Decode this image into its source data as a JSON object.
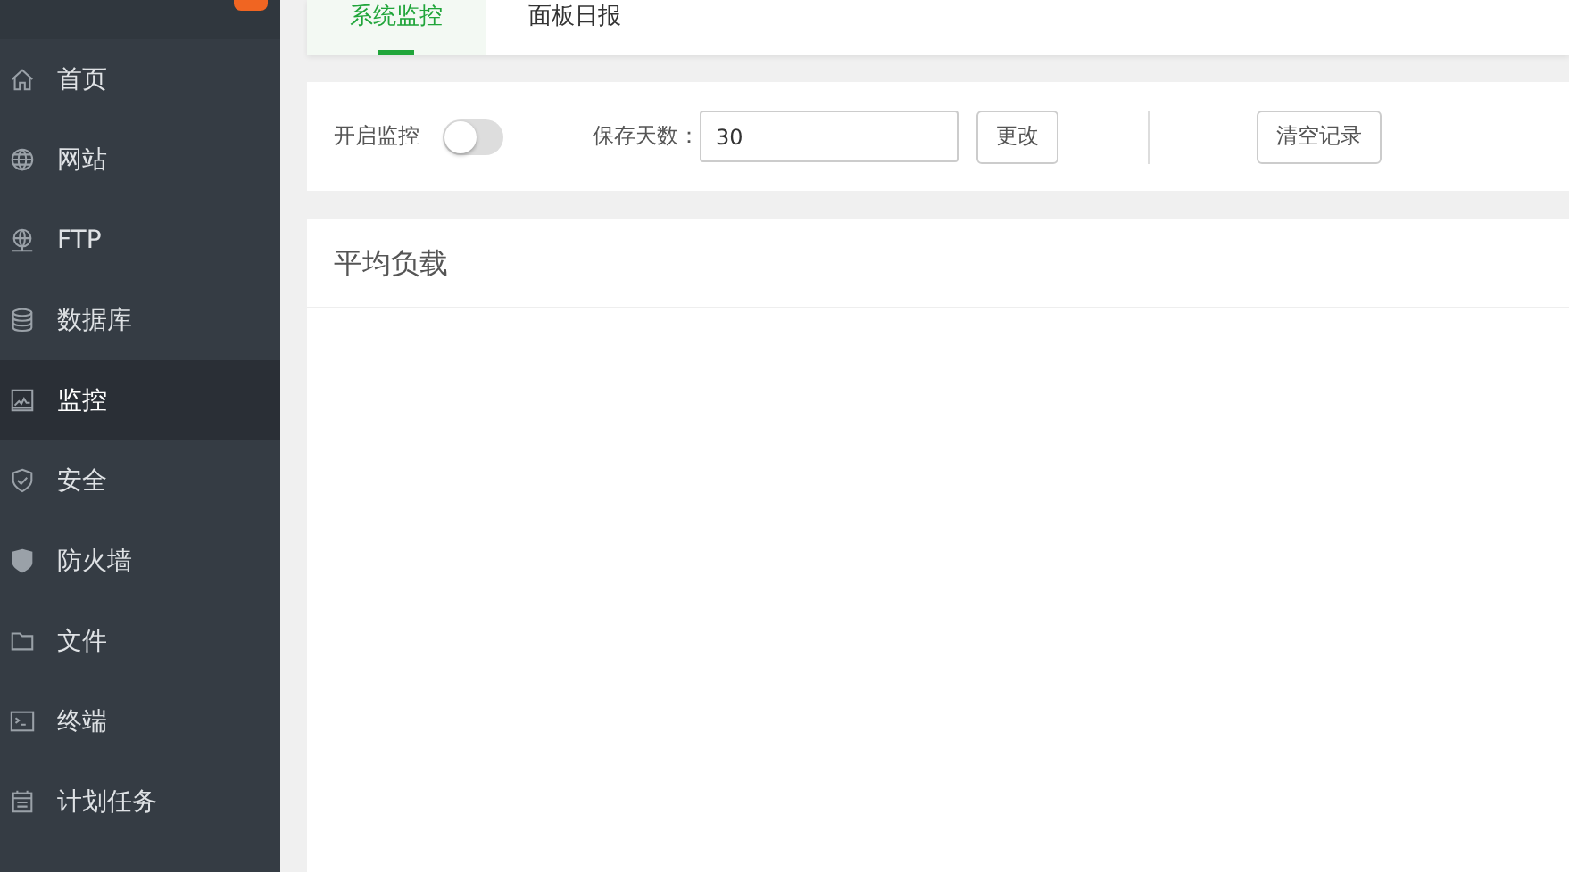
{
  "sidebar": {
    "items": [
      {
        "label": "首页",
        "kind": "home",
        "selected": false
      },
      {
        "label": "网站",
        "kind": "globe",
        "selected": false
      },
      {
        "label": "FTP",
        "kind": "ftp",
        "selected": false
      },
      {
        "label": "数据库",
        "kind": "database",
        "selected": false
      },
      {
        "label": "监控",
        "kind": "monitor",
        "selected": true
      },
      {
        "label": "安全",
        "kind": "shield",
        "selected": false
      },
      {
        "label": "防火墙",
        "kind": "firewall",
        "selected": false
      },
      {
        "label": "文件",
        "kind": "folder",
        "selected": false
      },
      {
        "label": "终端",
        "kind": "terminal",
        "selected": false
      },
      {
        "label": "计划任务",
        "kind": "calendar",
        "selected": false
      }
    ]
  },
  "tabs": [
    {
      "label": "系统监控",
      "selected": true
    },
    {
      "label": "面板日报",
      "selected": false
    }
  ],
  "controls": {
    "monitor_label": "开启监控",
    "monitor_on": false,
    "days_label": "保存天数：",
    "days_value": "30",
    "change_button": "更改",
    "clear_button": "清空记录"
  },
  "panel": {
    "title": "平均负载"
  }
}
